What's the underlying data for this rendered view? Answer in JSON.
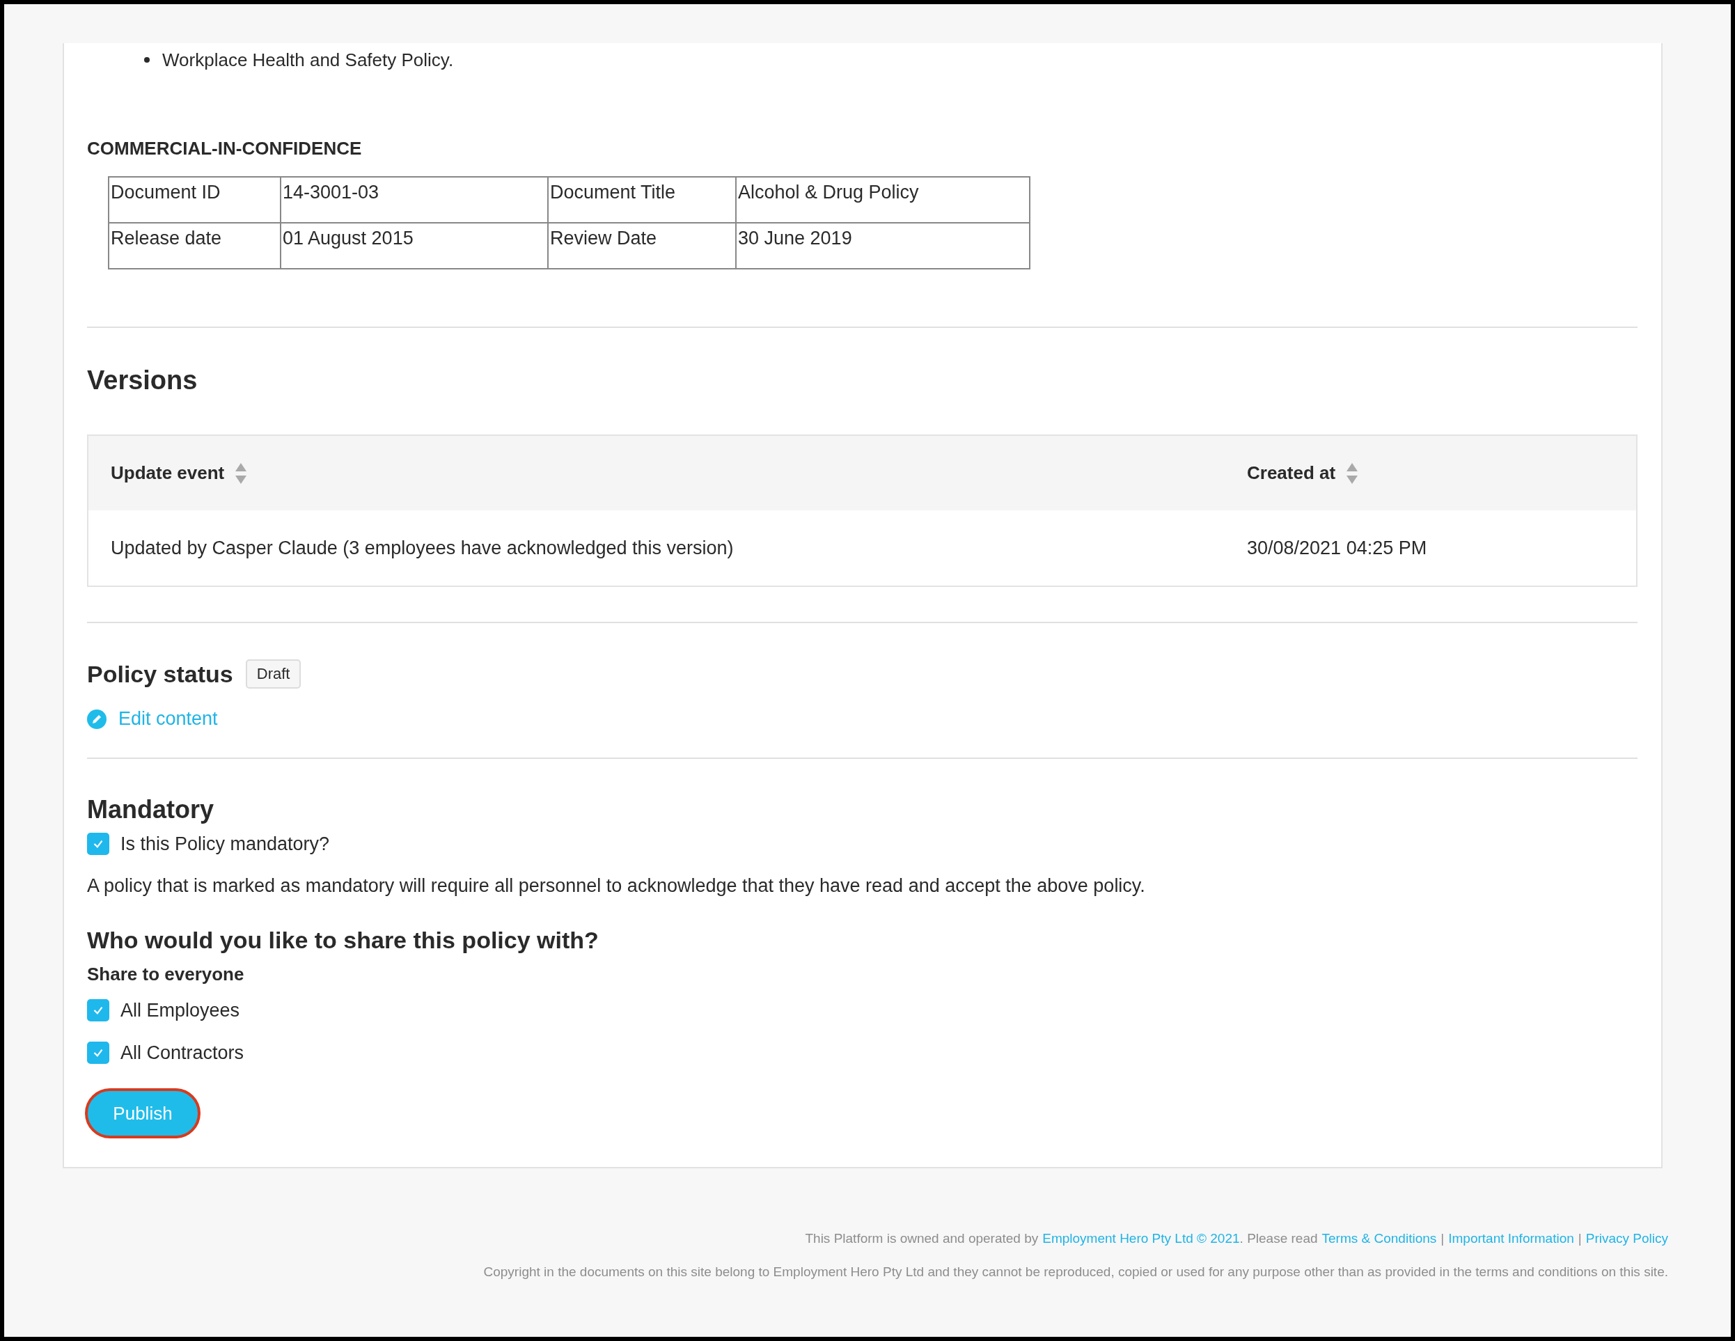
{
  "bullets": [
    "Workplace Health and Safety Policy."
  ],
  "document_control": {
    "heading": "COMMERCIAL-IN-CONFIDENCE",
    "rows": [
      [
        "Document ID",
        "14-3001-03",
        "Document Title",
        "Alcohol & Drug Policy"
      ],
      [
        "Release date",
        "01 August 2015",
        "Review Date",
        "30 June 2019"
      ]
    ]
  },
  "versions": {
    "title": "Versions",
    "columns": [
      {
        "label": "Update event"
      },
      {
        "label": "Created at"
      }
    ],
    "rows": [
      [
        "Updated by Casper Claude (3 employees have acknowledged this version)",
        "30/08/2021 04:25 PM"
      ]
    ]
  },
  "policy_status": {
    "label": "Policy status",
    "badge": "Draft",
    "edit_link": "Edit content"
  },
  "mandatory": {
    "title": "Mandatory",
    "checkbox": {
      "label": "Is this Policy mandatory?",
      "checked": true
    },
    "description": "A policy that is marked as mandatory will require all personnel to acknowledge that they have read and accept the above policy."
  },
  "sharing": {
    "title": "Who would you like to share this policy with?",
    "subtitle": "Share to everyone",
    "options": [
      {
        "label": "All Employees",
        "checked": true
      },
      {
        "label": "All Contractors",
        "checked": true
      }
    ]
  },
  "publish_button": "Publish",
  "footer": {
    "notice": [
      {
        "kind": "text",
        "text": "This Platform is owned and operated by"
      },
      {
        "kind": "link",
        "text": "Employment Hero Pty Ltd © 2021"
      },
      {
        "kind": "text",
        "text": ". Please read"
      },
      {
        "kind": "link",
        "text": "Terms & Conditions"
      },
      {
        "kind": "separator",
        "text": "|"
      },
      {
        "kind": "link",
        "text": "Important Information"
      },
      {
        "kind": "separator",
        "text": "|"
      },
      {
        "kind": "link",
        "text": "Privacy Policy"
      }
    ],
    "copyright": "Copyright in the documents on this site belong to Employment Hero Pty Ltd and they cannot be reproduced, copied or used for any purpose other than as provided in the terms and conditions on this site."
  }
}
